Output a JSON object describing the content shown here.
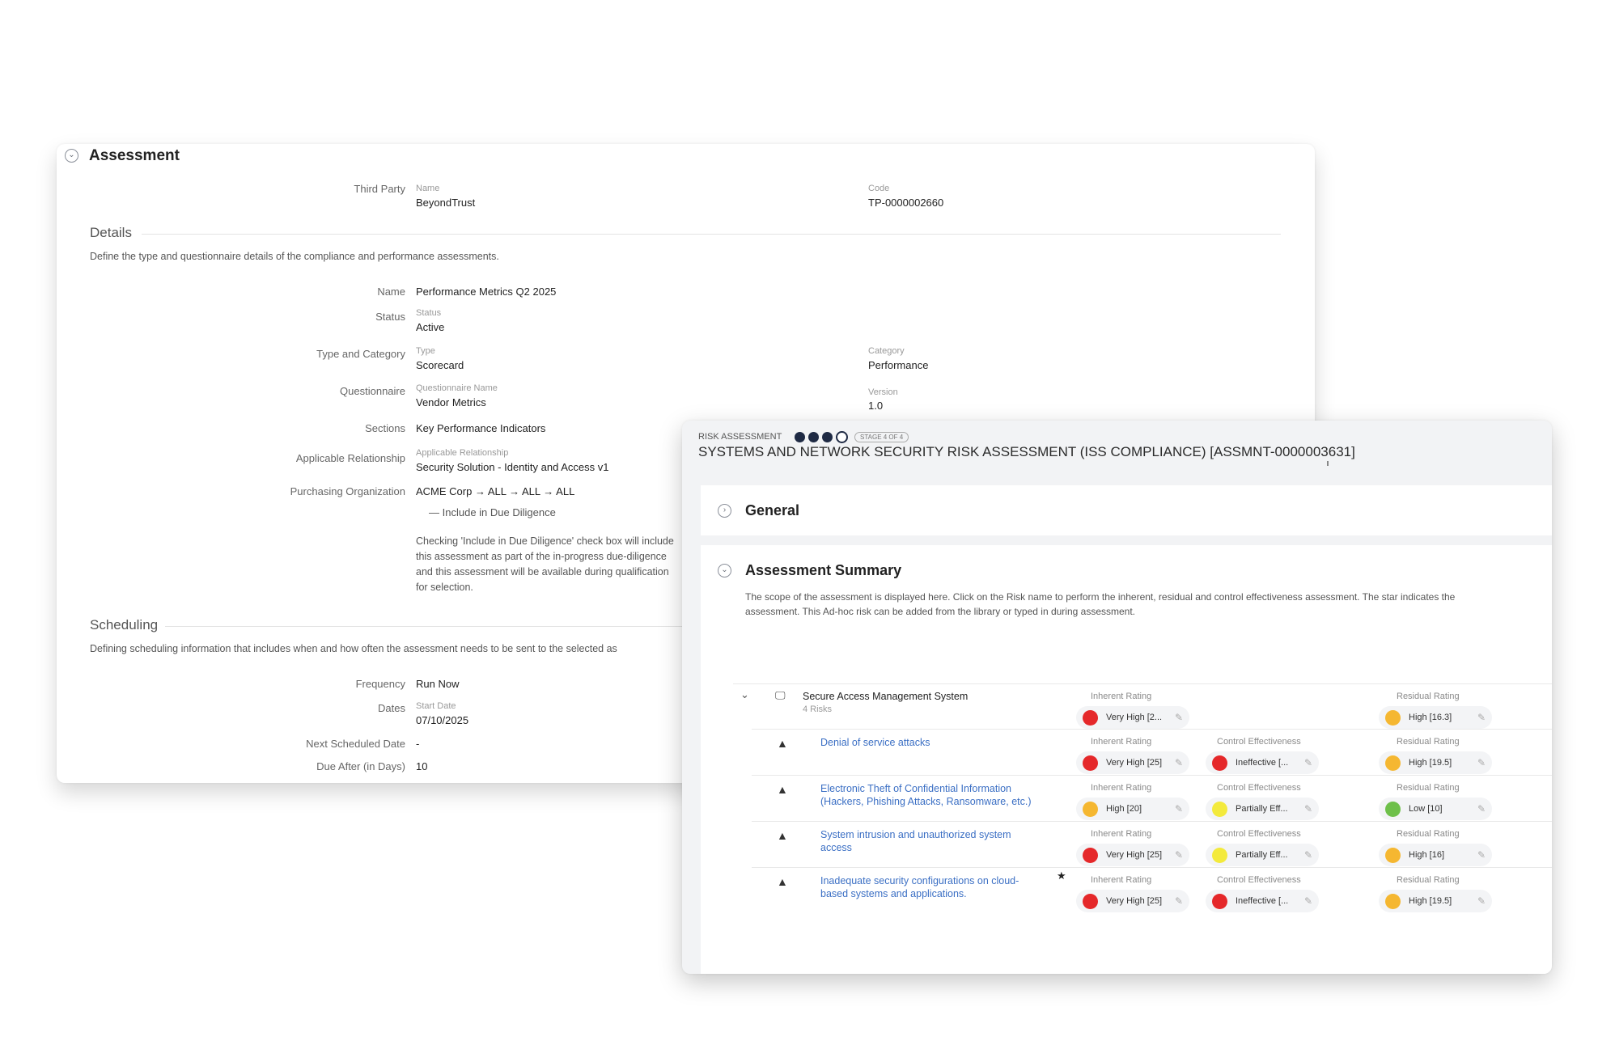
{
  "assessment": {
    "title": "Assessment",
    "third_party": {
      "label": "Third Party",
      "name_label": "Name",
      "name": "BeyondTrust",
      "code_label": "Code",
      "code": "TP-0000002660"
    },
    "details": {
      "title": "Details",
      "description": "Define the type and questionnaire details of the compliance and performance assessments.",
      "name_label": "Name",
      "name": "Performance Metrics Q2 2025",
      "status_label": "Status",
      "status_sublabel": "Status",
      "status": "Active",
      "type_category_label": "Type and Category",
      "type_sublabel": "Type",
      "type": "Scorecard",
      "category_sublabel": "Category",
      "category": "Performance",
      "questionnaire_label": "Questionnaire",
      "questionnaire_name_sublabel": "Questionnaire Name",
      "questionnaire_name": "Vendor Metrics",
      "version_sublabel": "Version",
      "version": "1.0",
      "sections_label": "Sections",
      "sections": "Key Performance Indicators",
      "applicable_relationship_label": "Applicable Relationship",
      "applicable_relationship_sublabel": "Applicable Relationship",
      "applicable_relationship": "Security Solution - Identity and Access v1",
      "purchasing_org_label": "Purchasing Organization",
      "purchasing_org": "ACME Corp → ALL → ALL → ALL",
      "due_diligence_label": "Include in Due Diligence",
      "due_diligence_help": [
        "Checking 'Include in Due Diligence' check box will include",
        "this assessment as part of the in-progress due-diligence",
        "and this assessment will be available during qualification",
        "for selection."
      ]
    },
    "scheduling": {
      "title": "Scheduling",
      "description": "Defining scheduling information that includes when and how often the assessment needs to be sent to the selected as",
      "frequency_label": "Frequency",
      "frequency": "Run Now",
      "dates_label": "Dates",
      "start_date_sublabel": "Start Date",
      "start_date": "07/10/2025",
      "next_scheduled_label": "Next Scheduled Date",
      "next_scheduled": "-",
      "due_after_label": "Due After (in Days)",
      "due_after": "10"
    }
  },
  "risk": {
    "breadcrumb": "RISK ASSESSMENT",
    "stage_badge": "STAGE 4 OF 4",
    "title": "SYSTEMS AND NETWORK SECURITY RISK ASSESSMENT (ISS COMPLIANCE) [ASSMNT-0000003631]",
    "general_title": "General",
    "summary_title": "Assessment Summary",
    "summary_desc": [
      "The scope of the assessment is displayed here. Click on the Risk name to perform the inherent, residual and control effectiveness assessment. The star indicates the",
      "assessment. This Ad-hoc risk can be added from the library or typed in during assessment."
    ],
    "group": {
      "name": "Secure Access Management System",
      "count": "4 Risks",
      "inherent_label": "Inherent Rating",
      "inherent": "Very High [2...",
      "residual_label": "Residual Rating",
      "residual": "High [16.3]"
    },
    "col_labels": {
      "inherent": "Inherent Rating",
      "control": "Control Effectiveness",
      "residual": "Residual Rating"
    },
    "rows": [
      {
        "name_lines": [
          "Denial of service attacks"
        ],
        "inherent": "Very High [25]",
        "control": "Ineffective [...",
        "residual": "High [19.5]",
        "starred": false
      },
      {
        "name_lines": [
          "Electronic Theft of Confidential Information",
          "(Hackers, Phishing Attacks, Ransomware, etc.)"
        ],
        "inherent": "High [20]",
        "control": "Partially Eff...",
        "residual": "Low [10]",
        "starred": false
      },
      {
        "name_lines": [
          "System intrusion and unauthorized system",
          "access"
        ],
        "inherent": "Very High [25]",
        "control": "Partially Eff...",
        "residual": "High [16]",
        "starred": false
      },
      {
        "name_lines": [
          "Inadequate security configurations on cloud-",
          "based systems and applications."
        ],
        "inherent": "Very High [25]",
        "control": "Ineffective [...",
        "residual": "High [19.5]",
        "starred": true
      }
    ]
  },
  "colors": {
    "red": "#e5282a",
    "orange": "#f5b731",
    "yellow": "#f3ea3c",
    "green": "#6ec04a",
    "link": "#3b6fc4",
    "navy": "#1f2a44"
  }
}
